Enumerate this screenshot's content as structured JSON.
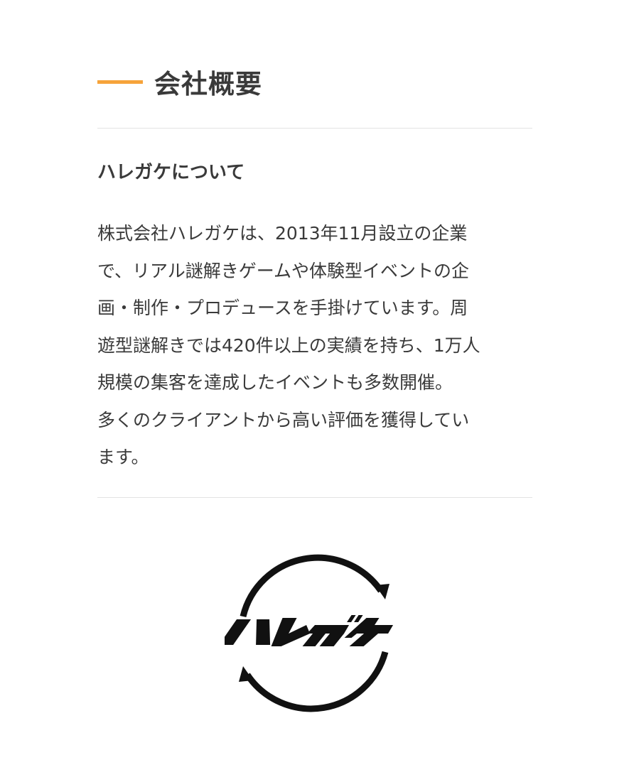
{
  "section": {
    "title": "会社概要",
    "subheading": "ハレガケについて",
    "description_lines": [
      "株式会社ハレガケは、2013年11月設立の企業",
      "で、リアル謎解きゲームや体験型イベントの企",
      "画・制作・プロデュースを手掛けています。周",
      "遊型謎解きでは420件以上の実績を持ち、1万人",
      "規模の集客を達成したイベントも多数開催。",
      "多くのクライアントから高い評価を獲得してい",
      "ます。"
    ],
    "logo_text": "ハレガケ"
  },
  "colors": {
    "accent": "#f6a33a",
    "text": "#3a3a3a",
    "divider": "#e3e3e3",
    "logo": "#111111"
  }
}
